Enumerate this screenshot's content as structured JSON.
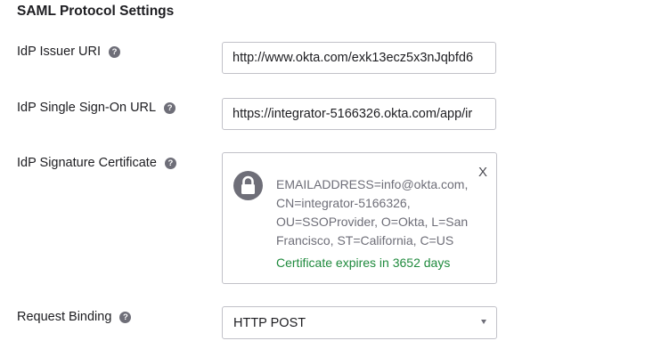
{
  "section": {
    "title": "SAML Protocol Settings"
  },
  "fields": {
    "issuer_uri": {
      "label": "IdP Issuer URI",
      "value": "http://www.okta.com/exk13ecz5x3nJqbfd6"
    },
    "sso_url": {
      "label": "IdP Single Sign-On URL",
      "value": "https://integrator-5166326.okta.com/app/ir"
    },
    "certificate": {
      "label": "IdP Signature Certificate",
      "details": "EMAILADDRESS=info@okta.com, CN=integrator-5166326, OU=SSOProvider, O=Okta, L=San Francisco, ST=California, C=US",
      "expiry": "Certificate expires in 3652 days",
      "close_label": "X"
    },
    "request_binding": {
      "label": "Request Binding",
      "selected": "HTTP POST"
    }
  },
  "icons": {
    "help": "help-icon",
    "help_glyph": "?",
    "lock": "lock-icon",
    "dropdown": "chevron-down-icon"
  },
  "colors": {
    "expiry_text": "#1f8a3d",
    "icon_gray": "#6e6e78",
    "border": "#c1c1c8"
  }
}
